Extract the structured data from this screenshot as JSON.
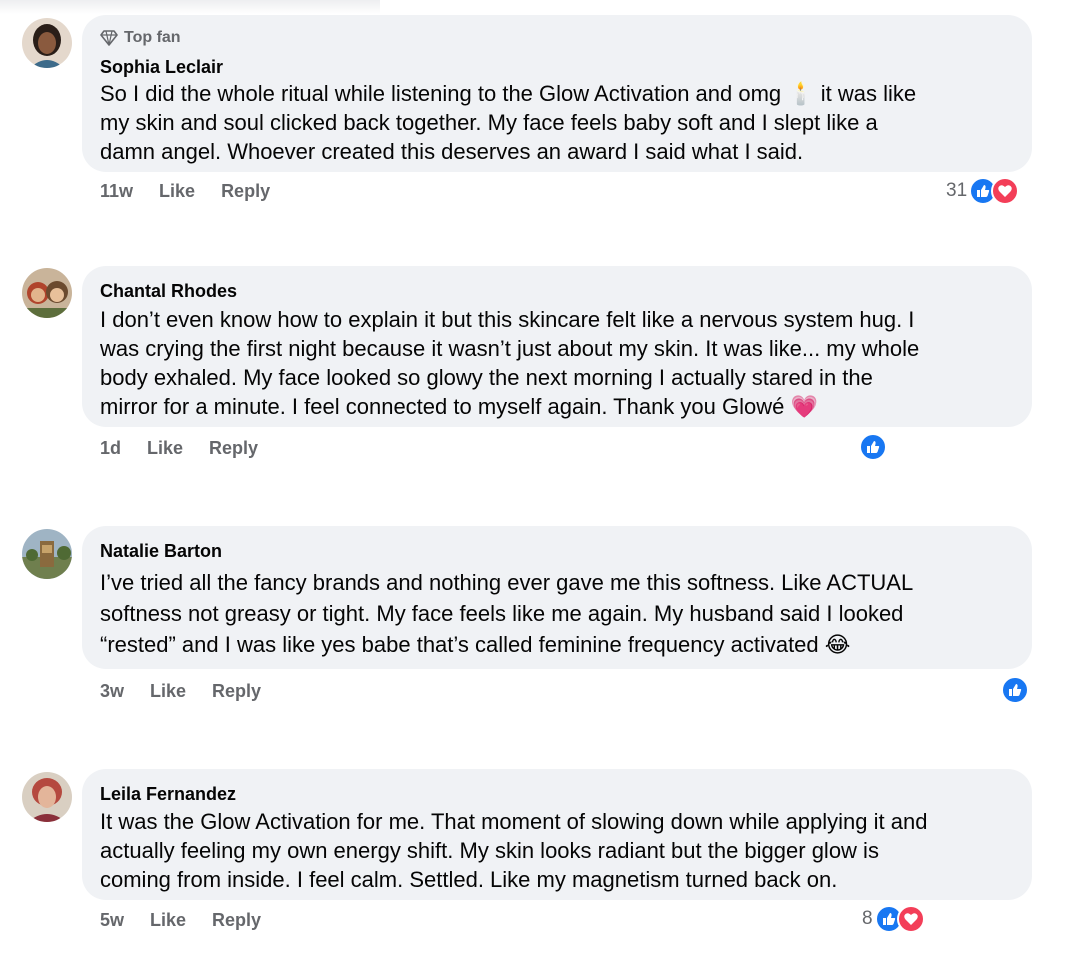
{
  "comments": [
    {
      "badge": "Top fan",
      "name": "Sophia Leclair",
      "lines": [
        "So I did the whole ritual while listening to the Glow Activation and omg 🕯️ it was like",
        "my skin and soul clicked back together. My face feels baby soft and I slept like a",
        "damn angel. Whoever created this deserves an award I said what I said."
      ],
      "time": "11w",
      "like": "Like",
      "reply": "Reply",
      "reaction_count": "31",
      "reactions": [
        "like",
        "love"
      ],
      "avatar_color": "#6b4a3a"
    },
    {
      "badge": "",
      "name": "Chantal Rhodes",
      "lines": [
        "I don’t even know how to explain it but this skincare felt like a nervous system hug. I",
        "was crying the first night because it wasn’t just about my skin. It was like... my whole",
        "body exhaled. My face looked so glowy the next morning I actually stared in the",
        "mirror for a minute. I feel connected to myself again. Thank you Glowé 💗"
      ],
      "time": "1d",
      "like": "Like",
      "reply": "Reply",
      "reaction_count": "",
      "reactions": [
        "like"
      ],
      "avatar_color": "#a0724f"
    },
    {
      "badge": "",
      "name": "Natalie Barton",
      "lines": [
        "I’ve tried all the fancy brands and nothing ever gave me this softness. Like ACTUAL",
        "softness not greasy or tight. My face feels like me again. My husband said I looked",
        "“rested” and I was like yes babe that’s called feminine frequency activated 😂"
      ],
      "time": "3w",
      "like": "Like",
      "reply": "Reply",
      "reaction_count": "",
      "reactions": [
        "like"
      ],
      "avatar_color": "#7f8f6a"
    },
    {
      "badge": "",
      "name": "Leila Fernandez",
      "lines": [
        "It was the Glow Activation for me. That moment of slowing down while applying it and",
        "actually feeling my own energy shift. My skin looks radiant but the bigger glow is",
        "coming from inside. I feel calm. Settled. Like my magnetism turned back on."
      ],
      "time": "5w",
      "like": "Like",
      "reply": "Reply",
      "reaction_count": "8",
      "reactions": [
        "like",
        "love"
      ],
      "avatar_color": "#b5493f"
    }
  ],
  "colors": {
    "bubble": "#f0f2f5",
    "meta_text": "#65676b",
    "like_blue": "#1877f2",
    "love_red": "#f33e58"
  }
}
